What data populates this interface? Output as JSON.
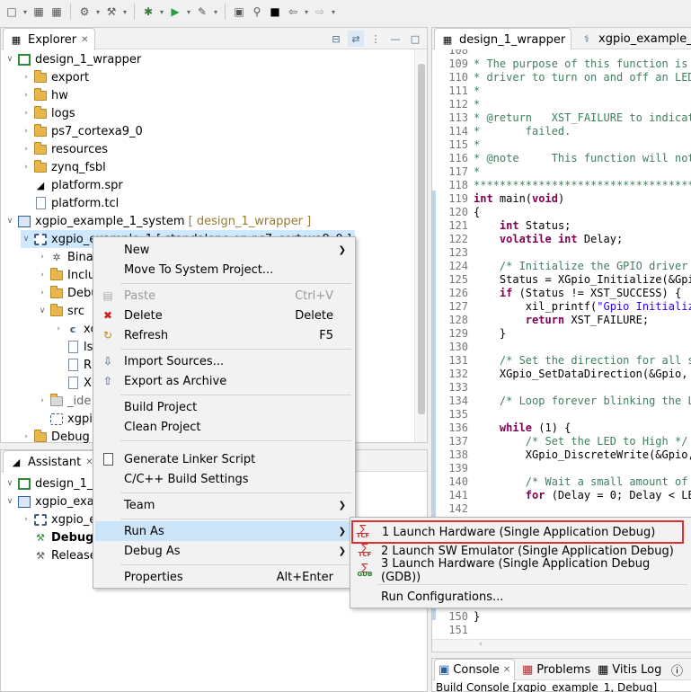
{
  "toolbar": {
    "icons": [
      "new-icon",
      "save-icon",
      "save-all-icon",
      "build-icon",
      "hammer-icon",
      "debug-icon",
      "run-icon",
      "tools-icon",
      "terminal-icon",
      "search-icon",
      "console-icon",
      "back-icon",
      "forward-icon"
    ]
  },
  "explorer": {
    "tab_label": "Explorer",
    "tree": [
      {
        "label": "design_1_wrapper",
        "icon": "project-icon",
        "expanded": true
      },
      {
        "label": "export"
      },
      {
        "label": "hw"
      },
      {
        "label": "logs"
      },
      {
        "label": "ps7_cortexa9_0"
      },
      {
        "label": "resources"
      },
      {
        "label": "zynq_fsbl"
      },
      {
        "label": "platform.spr"
      },
      {
        "label": "platform.tcl"
      },
      {
        "label": "xgpio_example_1_system",
        "suffix": "[ design_1_wrapper ]"
      },
      {
        "label": "xgpio_example_1 [ standalone on ps7_cortexa9_0 ]"
      },
      {
        "label": "Binar"
      },
      {
        "label": "Inclu"
      },
      {
        "label": "Debu"
      },
      {
        "label": "src"
      },
      {
        "label": "xc"
      },
      {
        "label": "lsc"
      },
      {
        "label": "RE"
      },
      {
        "label": "Xi"
      },
      {
        "label": "_ide"
      },
      {
        "label": "xgpi"
      },
      {
        "label": "Debug"
      }
    ]
  },
  "assistant": {
    "tab_label": "Assistant",
    "tree": [
      {
        "label": "design_1_w"
      },
      {
        "label": "xgpio_exa"
      },
      {
        "label": "xgpio_e"
      },
      {
        "label": "Debug"
      },
      {
        "label": "Release"
      }
    ]
  },
  "editor": {
    "tabs": [
      {
        "label": "design_1_wrapper"
      },
      {
        "label": "xgpio_example_1_s"
      }
    ],
    "lines": [
      {
        "n": "108",
        "t": ""
      },
      {
        "n": "109",
        "t": "* The purpose of this function is"
      },
      {
        "n": "110",
        "t": "* driver to turn on and off an LED"
      },
      {
        "n": "111",
        "t": "*"
      },
      {
        "n": "112",
        "t": "*"
      },
      {
        "n": "113",
        "t": "* @return   XST_FAILURE to indicat"
      },
      {
        "n": "114",
        "t": "*       failed."
      },
      {
        "n": "115",
        "t": "*"
      },
      {
        "n": "116",
        "t": "* @note     This function will not"
      },
      {
        "n": "117",
        "t": "*"
      },
      {
        "n": "118",
        "t": "************************************"
      },
      {
        "n": "119",
        "t": "int main(void)"
      },
      {
        "n": "120",
        "t": "{"
      },
      {
        "n": "121",
        "t": "    int Status;"
      },
      {
        "n": "122",
        "t": "    volatile int Delay;"
      },
      {
        "n": "123",
        "t": ""
      },
      {
        "n": "124",
        "t": "    /* Initialize the GPIO driver"
      },
      {
        "n": "125",
        "t": "    Status = XGpio_Initialize(&Gpi"
      },
      {
        "n": "126",
        "t": "    if (Status != XST_SUCCESS) {"
      },
      {
        "n": "127",
        "t": "        xil_printf(\"Gpio Initializ"
      },
      {
        "n": "128",
        "t": "        return XST_FAILURE;"
      },
      {
        "n": "129",
        "t": "    }"
      },
      {
        "n": "130",
        "t": ""
      },
      {
        "n": "131",
        "t": "    /* Set the direction for all s"
      },
      {
        "n": "132",
        "t": "    XGpio_SetDataDirection(&Gpio,"
      },
      {
        "n": "133",
        "t": ""
      },
      {
        "n": "134",
        "t": "    /* Loop forever blinking the L"
      },
      {
        "n": "135",
        "t": ""
      },
      {
        "n": "136",
        "t": "    while (1) {"
      },
      {
        "n": "137",
        "t": "        /* Set the LED to High */"
      },
      {
        "n": "138",
        "t": "        XGpio_DiscreteWrite(&Gpio,"
      },
      {
        "n": "139",
        "t": ""
      },
      {
        "n": "140",
        "t": "        /* Wait a small amount of"
      },
      {
        "n": "141",
        "t": "        for (Delay = 0; Delay < LE"
      },
      {
        "n": "142",
        "t": ""
      },
      {
        "n": "143",
        "t": ""
      },
      {
        "n": "144",
        "t": ""
      },
      {
        "n": "145",
        "t": ""
      },
      {
        "n": "146",
        "t": ""
      },
      {
        "n": "147",
        "t": ""
      },
      {
        "n": "148",
        "t": ""
      },
      {
        "n": "149",
        "t": ""
      },
      {
        "n": "150",
        "t": "}"
      },
      {
        "n": "151",
        "t": ""
      }
    ]
  },
  "context_menu": {
    "items": [
      {
        "label": "New",
        "submenu": true
      },
      {
        "label": "Move To System Project..."
      },
      {
        "label": "Paste",
        "key": "Ctrl+V",
        "disabled": true,
        "icon": "paste-icon"
      },
      {
        "label": "Delete",
        "key": "Delete",
        "icon": "delete-icon"
      },
      {
        "label": "Refresh",
        "key": "F5",
        "icon": "refresh-icon"
      },
      {
        "label": "Import Sources...",
        "icon": "import-icon"
      },
      {
        "label": "Export as Archive",
        "icon": "export-icon"
      },
      {
        "label": "Build Project"
      },
      {
        "label": "Clean Project"
      },
      {
        "label": "Generate Linker Script",
        "icon": "linker-icon"
      },
      {
        "label": "C/C++ Build Settings"
      },
      {
        "label": "Team",
        "submenu": true
      },
      {
        "label": "Run As",
        "submenu": true,
        "highlighted": true
      },
      {
        "label": "Debug As",
        "submenu": true
      },
      {
        "label": "Properties",
        "key": "Alt+Enter"
      }
    ]
  },
  "run_as_submenu": {
    "items": [
      {
        "label": "1 Launch Hardware (Single Application Debug)",
        "badge": "TCF"
      },
      {
        "label": "2 Launch SW Emulator (Single Application Debug)",
        "badge": "TCF"
      },
      {
        "label": "3 Launch Hardware (Single Application Debug (GDB))",
        "badge": "GDB"
      },
      {
        "label": "Run Configurations..."
      }
    ],
    "highlight_color": "#e03030"
  },
  "bottom_panel": {
    "tabs": [
      {
        "label": "Console"
      },
      {
        "label": "Problems"
      },
      {
        "label": "Vitis Log"
      }
    ],
    "console_title": "Build Console [xgpio_example_1, Debug]"
  }
}
